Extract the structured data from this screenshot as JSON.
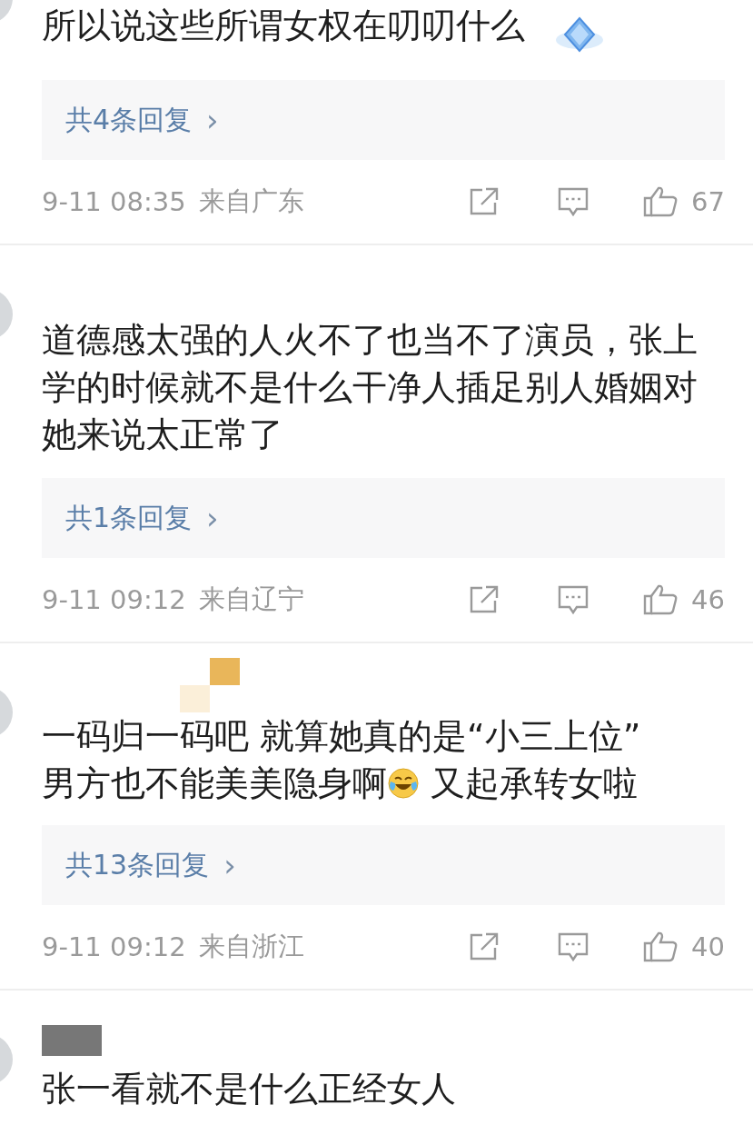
{
  "comments": [
    {
      "kind": "plain",
      "badge": true,
      "text": [
        {
          "kind": "text",
          "text": "所以说这些所谓女权在叨叨什么"
        }
      ],
      "replies": "共4条回复",
      "chevron": "›",
      "time": "9-11 08:35",
      "location": "来自广东",
      "likes": "67"
    },
    {
      "kind": "plain",
      "badge": false,
      "text": [
        {
          "kind": "text",
          "text": "道德感太强的人火不了也当不了演员，张上学的时候就不是什么干净人插足别人婚姻对她来说太正常了"
        }
      ],
      "replies": "共1条回复",
      "chevron": "›",
      "time": "9-11 09:12",
      "location": "来自辽宁",
      "likes": "46"
    },
    {
      "kind": "mosaic",
      "badge": false,
      "text": [
        {
          "kind": "text",
          "text": "一码归一码吧 就算她真的是“小三上位”"
        },
        {
          "kind": "break"
        },
        {
          "kind": "text",
          "text": "男方也不能美美隐身啊"
        },
        {
          "kind": "emoji"
        },
        {
          "kind": "text",
          "text": " 又起承转女啦"
        }
      ],
      "replies": "共13条回复",
      "chevron": "›",
      "time": "9-11 09:12",
      "location": "来自浙江",
      "likes": "40"
    },
    {
      "kind": "bar",
      "badge": false,
      "text": [
        {
          "kind": "text",
          "text": "张一看就不是什么正经女人"
        }
      ]
    }
  ]
}
